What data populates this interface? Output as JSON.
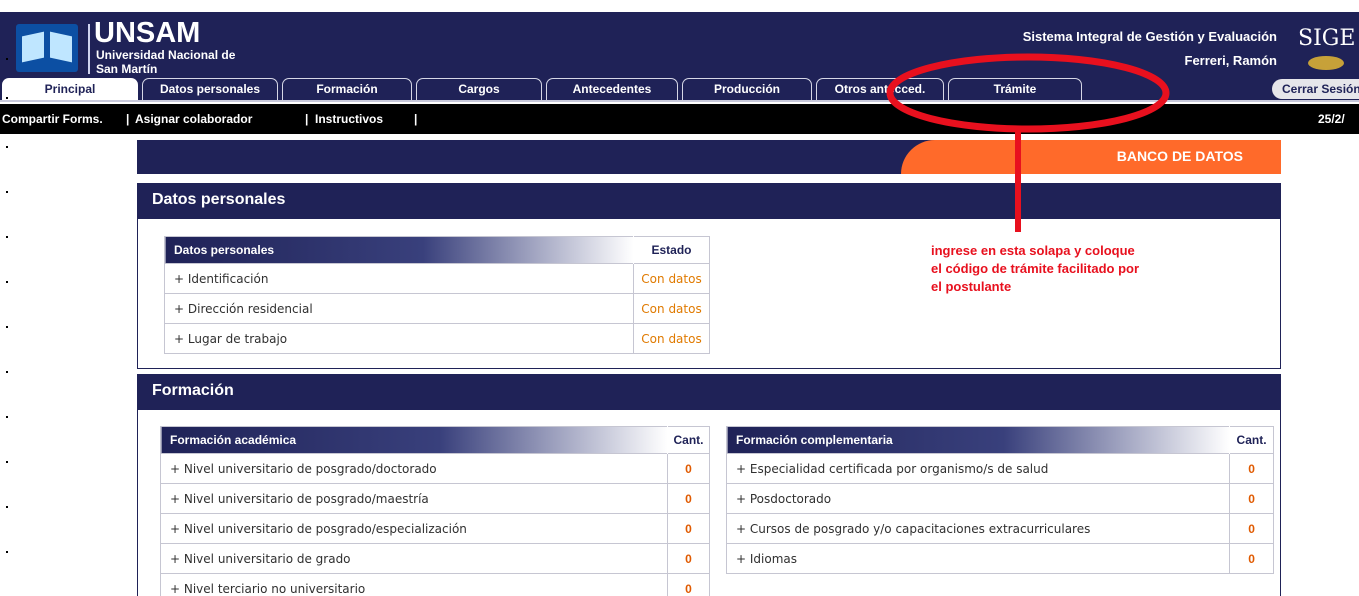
{
  "header": {
    "brand": "UNSAM",
    "university_line1": "Universidad Nacional de",
    "university_line2": "San Martín",
    "system_title": "Sistema Integral de Gestión y Evaluación",
    "user": "Ferreri, Ramón",
    "sige_logo_text": "SIGE"
  },
  "tabs": [
    {
      "label": "Principal",
      "active": true
    },
    {
      "label": "Datos personales",
      "active": false
    },
    {
      "label": "Formación",
      "active": false
    },
    {
      "label": "Cargos",
      "active": false
    },
    {
      "label": "Antecedentes",
      "active": false
    },
    {
      "label": "Producción",
      "active": false
    },
    {
      "label": "Otros antecced.",
      "active": false
    },
    {
      "label": "Trámite",
      "active": false
    }
  ],
  "cerrar_label": "Cerrar Sesión",
  "submenu": {
    "items": [
      "Compartir Forms.",
      "Asignar colaborador",
      "Instructivos"
    ],
    "separator": "|",
    "date": "25/2/"
  },
  "banner": {
    "label": "BANCO DE DATOS"
  },
  "datos_personales": {
    "title": "Datos personales",
    "table": {
      "header": "Datos personales",
      "status_header": "Estado",
      "rows": [
        {
          "label": "+ Identificación",
          "status": "Con datos"
        },
        {
          "label": "+ Dirección residencial",
          "status": "Con datos"
        },
        {
          "label": "+ Lugar de trabajo",
          "status": "Con datos"
        }
      ]
    }
  },
  "annotation": {
    "text": "ingrese en esta solapa y coloque el código de trámite facilitado por el postulante",
    "color": "#e8101e"
  },
  "formacion": {
    "title": "Formación",
    "academica": {
      "header": "Formación académica",
      "count_header": "Cant.",
      "rows": [
        {
          "label": "+ Nivel universitario de posgrado/doctorado",
          "count": "0"
        },
        {
          "label": "+ Nivel universitario de posgrado/maestría",
          "count": "0"
        },
        {
          "label": "+ Nivel universitario de posgrado/especialización",
          "count": "0"
        },
        {
          "label": "+ Nivel universitario de grado",
          "count": "0"
        },
        {
          "label": "+ Nivel terciario no universitario",
          "count": "0"
        }
      ]
    },
    "complementaria": {
      "header": "Formación complementaria",
      "count_header": "Cant.",
      "rows": [
        {
          "label": "+ Especialidad certificada por organismo/s de salud",
          "count": "0"
        },
        {
          "label": "+ Posdoctorado",
          "count": "0"
        },
        {
          "label": "+ Cursos de posgrado y/o capacitaciones extracurriculares",
          "count": "0"
        },
        {
          "label": "+ Idiomas",
          "count": "0"
        }
      ]
    }
  },
  "colors": {
    "navy": "#1f2257",
    "orange": "#ff6a2a",
    "status_orange": "#e07a00"
  }
}
